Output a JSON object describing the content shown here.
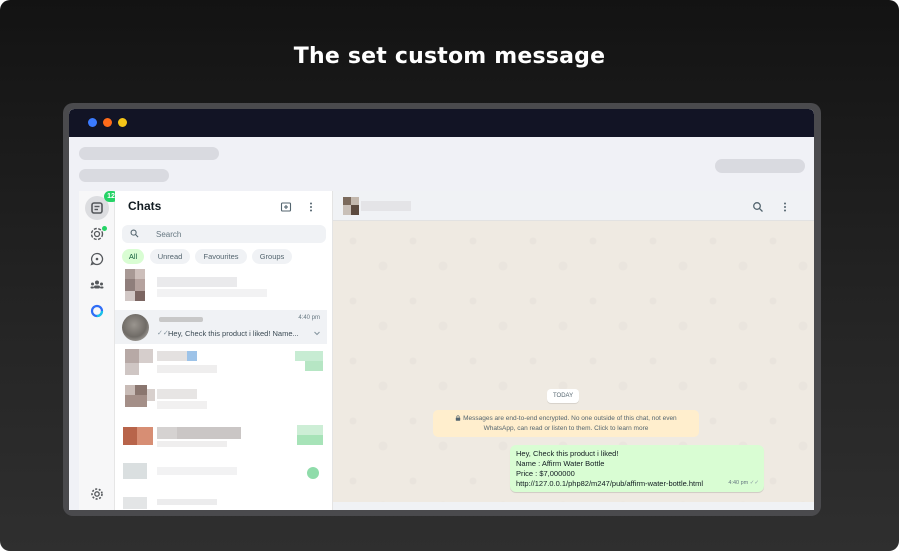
{
  "headline": "The set custom message",
  "sidebar": {
    "badge_count": "12"
  },
  "chat_list": {
    "title": "Chats",
    "search_placeholder": "Search",
    "filters": [
      "All",
      "Unread",
      "Favourites",
      "Groups"
    ],
    "active_filter": "All",
    "selected_chat": {
      "time": "4:40 pm",
      "ticks": "✓✓",
      "preview": "Hey, Check this product i liked! Name..."
    }
  },
  "conversation": {
    "date_chip": "TODAY",
    "encryption_notice": "Messages are end-to-end encrypted. No one outside of this chat, not even WhatsApp, can read or listen to them. Click to learn more",
    "message": {
      "lines": [
        "Hey, Check this product i liked!",
        "Name : Affirm Water Bottle",
        "Price : $7,000000",
        "http://127.0.0.1/php82/m247/pub/affirm-water-bottle.html"
      ],
      "time": "4:40 pm",
      "ticks": "✓✓"
    }
  },
  "colors": {
    "background_dark": "#1a1a1a",
    "whatsapp_green": "#25d366",
    "outgoing_bubble": "#d9fdd3",
    "chat_background": "#efeae2",
    "notice_background": "#ffeecd"
  }
}
